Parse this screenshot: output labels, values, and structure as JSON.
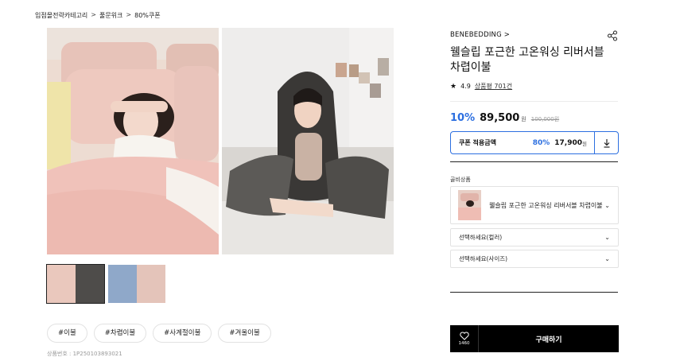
{
  "breadcrumb": [
    "입점몰전략카테고리",
    "풀문위크",
    "80%쿠폰"
  ],
  "breadcrumb_sep": ">",
  "product": {
    "brand": "BENEBEDDING >",
    "title": "웰슬립 포근한 고온워싱 리버서블 차렵이불",
    "rating": "4.9",
    "reviews": "상품평 701건",
    "discount": "10%",
    "price": "89,500",
    "price_unit": "원",
    "original_price": "100,000원",
    "code": "상품번호 : 1P250103893021"
  },
  "coupon": {
    "label": "쿠폰 적용금액",
    "percent": "80%",
    "price": "17,900",
    "unit": "원"
  },
  "options": {
    "section_label": "골비상품",
    "item_name": "웰슬립 포근한 고온워싱 리버서블 차렵이불",
    "color_placeholder": "선택하세요(컬러)",
    "size_placeholder": "선택하세요(사이즈)"
  },
  "tags": [
    "#이불",
    "#차렵이불",
    "#사계절이불",
    "#겨울이불"
  ],
  "buy": {
    "wish_count": "1460",
    "buy_label": "구매하기"
  },
  "colors": {
    "accent_blue": "#2c6fe0",
    "pink_bedding": "#efc3bb",
    "gray_blanket": "#4d4b49"
  },
  "icons": [
    "share-icon",
    "star-icon",
    "download-icon",
    "chevron-down-icon",
    "heart-icon"
  ]
}
